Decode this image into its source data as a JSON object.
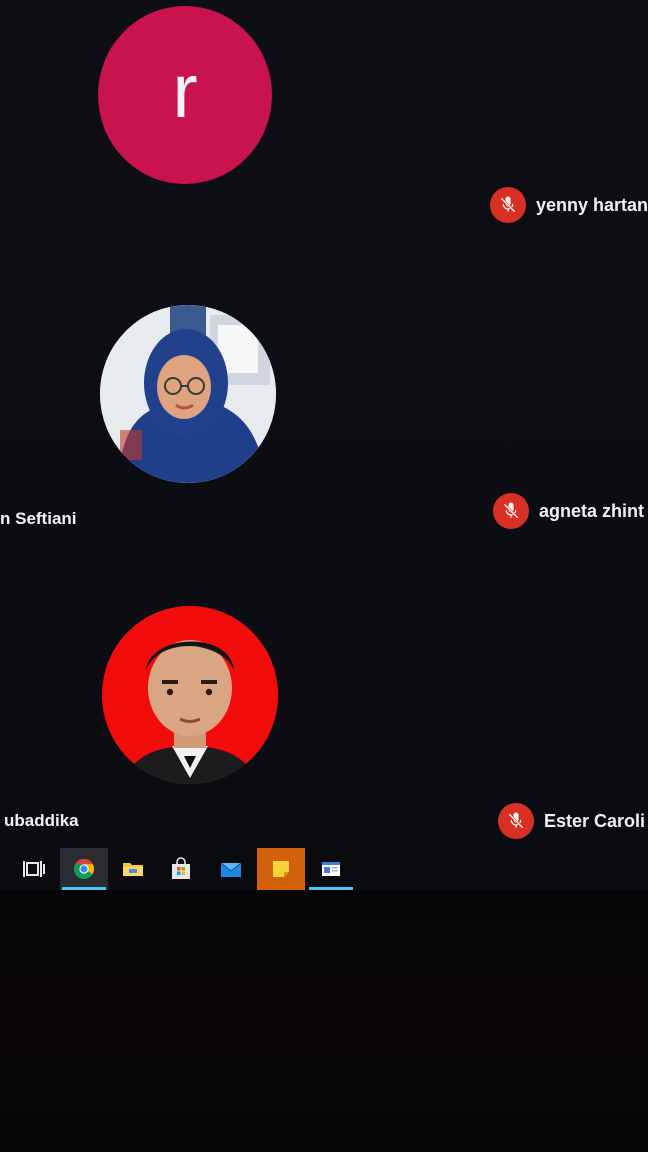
{
  "participants": {
    "tile1": {
      "avatar_letter": "r",
      "avatar_color": "#c9134f",
      "right_name": "yenny hartan",
      "right_muted": true
    },
    "tile2": {
      "left_name": "n Seftiani",
      "right_name": "agneta zhint",
      "right_muted": true
    },
    "tile3": {
      "left_name": "ubaddika",
      "right_name": "Ester Caroli",
      "right_muted": true
    }
  },
  "icons": {
    "mic_off": "mic-off-icon",
    "mic_off_color": "#d93025"
  },
  "taskbar": {
    "items": [
      {
        "name": "task-view",
        "icon": "task-view-icon",
        "active": false
      },
      {
        "name": "chrome",
        "icon": "chrome-icon",
        "active": true
      },
      {
        "name": "file-explorer",
        "icon": "folder-icon",
        "active": false
      },
      {
        "name": "store",
        "icon": "store-bag-icon",
        "active": false
      },
      {
        "name": "mail",
        "icon": "mail-icon",
        "active": false
      },
      {
        "name": "sticky-notes",
        "icon": "sticky-note-icon",
        "active": false
      },
      {
        "name": "news",
        "icon": "news-window-icon",
        "active": false
      }
    ],
    "accent": "#4fc3f7"
  }
}
